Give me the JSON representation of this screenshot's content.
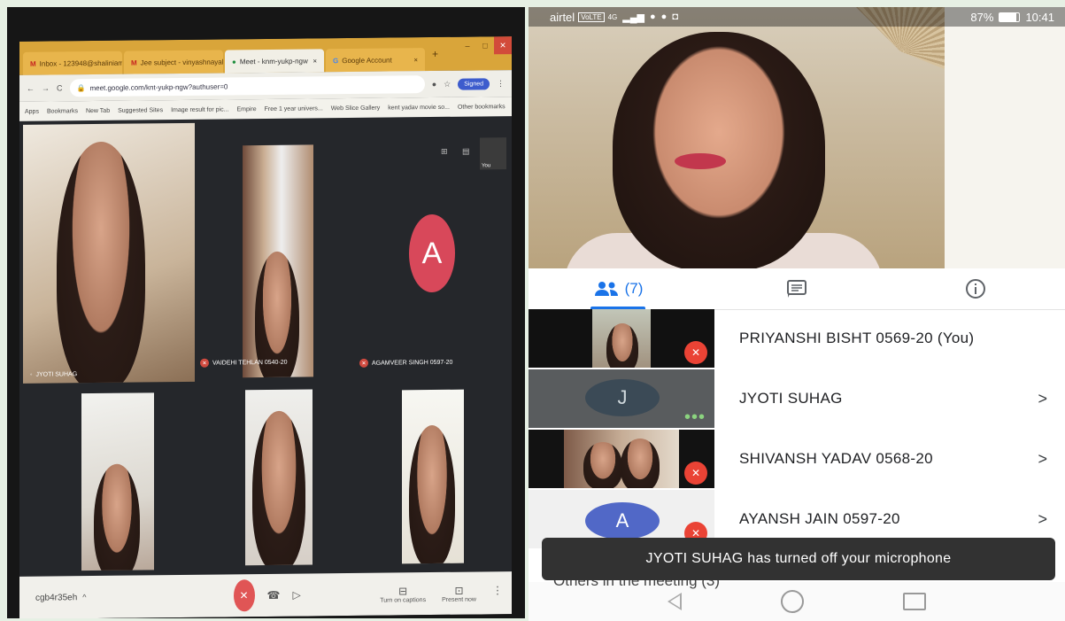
{
  "laptop": {
    "tabs": [
      {
        "label": "Inbox - 123948@shaliniam.x..."
      },
      {
        "label": "Jee subject - vinyashnayaktha..."
      },
      {
        "label": "Meet - knm-yukp-ngw"
      },
      {
        "label": "Google Account"
      }
    ],
    "new_tab": "+",
    "window_controls": {
      "min": "–",
      "max": "□",
      "close": "✕"
    },
    "url": "meet.google.com/knt-yukp-ngw?authuser=0",
    "signin": "Signed",
    "bookmarks": [
      "Apps",
      "Bookmarks",
      "New Tab",
      "Suggested Sites",
      "Image result for pic...",
      "Empire",
      "Free 1 year univers...",
      "Web Slice Gallery",
      "kent yadav movie so...",
      "Other bookmarks"
    ],
    "tiles": [
      {
        "name": "JYOTI SUHAG"
      },
      {
        "name": "VAIDEHI TEHLAN 0540-20"
      },
      {
        "name": "AGAMVEER SINGH 0597-20",
        "initial": "A"
      }
    ],
    "self_label": "You",
    "meeting_code": "cgb4r35eh",
    "meeting_code_caret": "^",
    "controls": {
      "captions": "Turn on captions",
      "present": "Present now"
    }
  },
  "phone": {
    "status": {
      "carrier": "airtel",
      "volte": "VoLTE",
      "network": "4G",
      "battery": "87%",
      "time": "10:41"
    },
    "tabs": {
      "people_count": "(7)"
    },
    "participants": [
      {
        "name": "PRIYANSHI BISHT 0569-20 (You)",
        "muted": true,
        "chevron": ""
      },
      {
        "name": "JYOTI SUHAG",
        "initial": "J",
        "muted": false,
        "chevron": ">"
      },
      {
        "name": "SHIVANSH YADAV 0568-20",
        "muted": true,
        "chevron": ">"
      },
      {
        "name": "AYANSH JAIN 0597-20",
        "initial": "A",
        "muted": true,
        "chevron": ">"
      }
    ],
    "toast": "JYOTI SUHAG has turned off your microphone",
    "others_heading": "Others in the meeting (3)"
  },
  "colors": {
    "meet_blue": "#1a73e8",
    "mute_red": "#ea4335",
    "tab_bar": "#d9a53a"
  }
}
